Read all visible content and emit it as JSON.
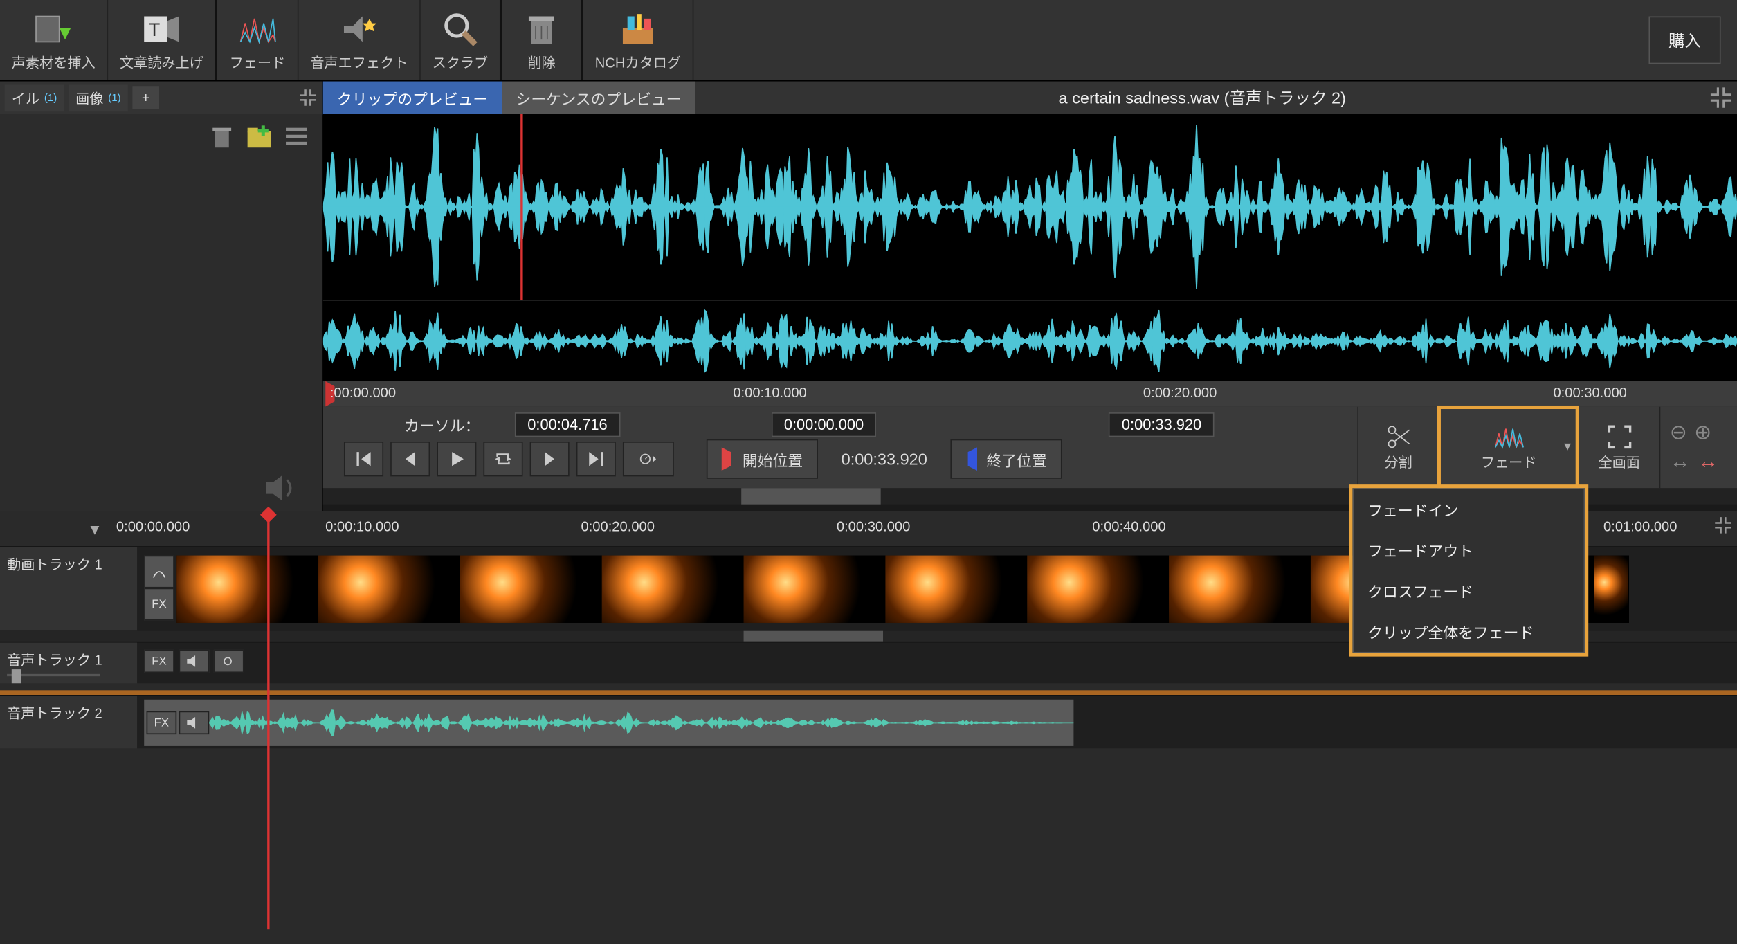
{
  "colors": {
    "accent": "#3a66b0",
    "highlight": "#e8a33c",
    "waveform": "#4fc5d6",
    "waveform2": "#55c9b1"
  },
  "toolbar": {
    "insert_audio": "声素材を挿入",
    "tts": "文章読み上げ",
    "fade": "フェード",
    "audio_fx": "音声エフェクト",
    "scrub": "スクラブ",
    "delete": "削除",
    "nch_catalog": "NCHカタログ",
    "buy": "購入"
  },
  "bin": {
    "tab_file": "イル",
    "tab_file_count": "(1)",
    "tab_image": "画像",
    "tab_image_count": "(1)",
    "add_tab": "+"
  },
  "preview": {
    "tab_clip": "クリップのプレビュー",
    "tab_sequence": "シーケンスのプレビュー",
    "title": "a certain sadness.wav (音声トラック 2)",
    "ruler": {
      "t0": ":00:00.000",
      "t10": "0:00:10.000",
      "t20": "0:00:20.000",
      "t30": "0:00:30.000"
    },
    "cursor_label": "カーソル：",
    "cursor_value": "0:00:04.716",
    "start_value": "0:00:00.000",
    "end_value": "0:00:33.920",
    "duration": "0:00:33.920",
    "start_label": "開始位置",
    "end_label": "終了位置",
    "split": "分割",
    "fade": "フェード",
    "fullscreen": "全画面"
  },
  "fade_menu": {
    "in": "フェードイン",
    "out": "フェードアウト",
    "cross": "クロスフェード",
    "whole": "クリップ全体をフェード"
  },
  "timeline": {
    "t0": "0:00:00.000",
    "t10": "0:00:10.000",
    "t20": "0:00:20.000",
    "t30": "0:00:30.000",
    "t40": "0:00:40.000",
    "t60": "0:01:00.000",
    "video_track": "動画トラック 1",
    "audio_track1": "音声トラック 1",
    "audio_track2": "音声トラック 2",
    "fx_chip": "FX"
  }
}
